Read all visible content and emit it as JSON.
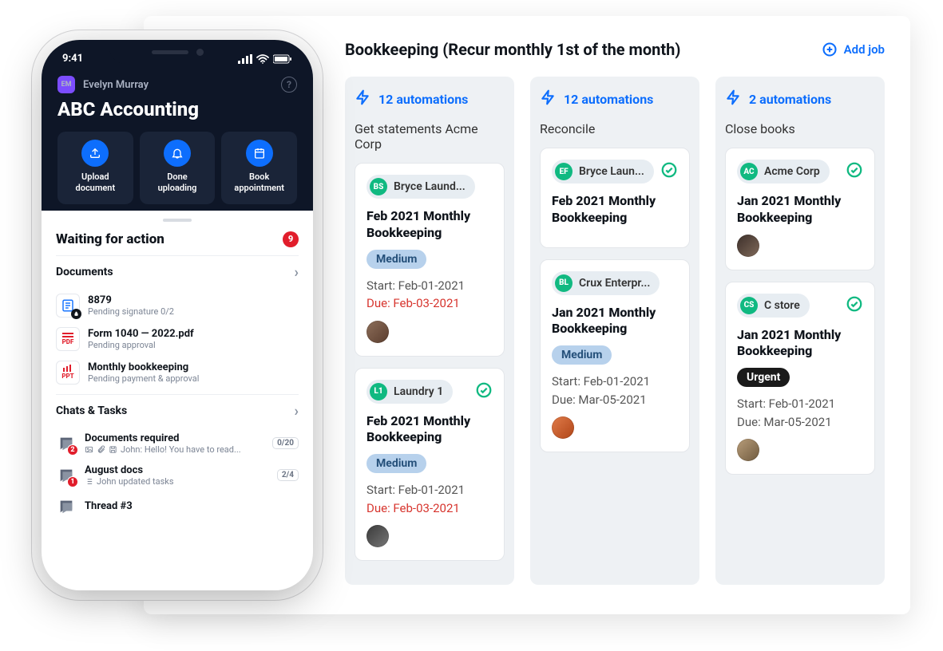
{
  "desk": {
    "title": "Bookkeeping (Recur monthly 1st of the month)",
    "add_label": "Add job",
    "columns": [
      {
        "automations": "12 automations",
        "name": "Get statements Acme Corp",
        "cards": [
          {
            "chip": "BS",
            "chip_color": "#10b981",
            "client": "Bryce Laund...",
            "title": "Feb 2021 Monthly Bookkeeping",
            "badge": "Medium",
            "badge_kind": "medium",
            "start": "Start: Feb-01-2021",
            "due": "Due: Feb-03-2021",
            "due_red": true,
            "avatar": "linear-gradient(135deg,#8d6e5a,#5a3d2e)",
            "check": false
          },
          {
            "chip": "L1",
            "chip_color": "#10b981",
            "client": "Laundry 1",
            "title": "Feb 2021 Monthly Bookkeeping",
            "badge": "Medium",
            "badge_kind": "medium",
            "start": "Start: Feb-01-2021",
            "due": "Due: Feb-03-2021",
            "due_red": true,
            "avatar": "linear-gradient(135deg,#3a3a3a,#777)",
            "check": true
          }
        ]
      },
      {
        "automations": "12 automations",
        "name": "Reconcile",
        "cards": [
          {
            "chip": "EF",
            "chip_color": "#10b981",
            "client": "Bryce Laun...",
            "title": "Feb 2021 Monthly Bookkeeping",
            "badge": "",
            "badge_kind": "",
            "start": "",
            "due": "",
            "due_red": false,
            "avatar": "",
            "check": true
          },
          {
            "chip": "BL",
            "chip_color": "#10b981",
            "client": "Crux Enterpr...",
            "title": "Jan 2021 Monthly Bookkeeping",
            "badge": "Medium",
            "badge_kind": "medium",
            "start": "Start: Feb-01-2021",
            "due": "Due: Mar-05-2021",
            "due_red": false,
            "avatar": "linear-gradient(135deg,#e07b4a,#b04517)",
            "check": false
          }
        ]
      },
      {
        "automations": "2 automations",
        "name": "Close books",
        "cards": [
          {
            "chip": "AC",
            "chip_color": "#10b981",
            "client": "Acme Corp",
            "title": "Jan 2021 Monthly Bookkeeping",
            "badge": "",
            "badge_kind": "",
            "start": "",
            "due": "",
            "due_red": false,
            "avatar": "linear-gradient(135deg,#3c2f2a,#806a5a)",
            "check": true
          },
          {
            "chip": "CS",
            "chip_color": "#10b981",
            "client": "C store",
            "title": "Jan 2021 Monthly Bookkeeping",
            "badge": "Urgent",
            "badge_kind": "urgent",
            "start": "Start: Feb-01-2021",
            "due": "Due: Mar-05-2021",
            "due_red": false,
            "avatar": "linear-gradient(135deg,#b89d7a,#6f5a3e)",
            "check": true
          }
        ]
      }
    ]
  },
  "phone": {
    "time": "9:41",
    "user_initials": "EM",
    "user_name": "Evelyn Murray",
    "org": "ABC Accounting",
    "actions": [
      {
        "icon": "upload",
        "l1": "Upload",
        "l2": "document"
      },
      {
        "icon": "bell",
        "l1": "Done",
        "l2": "uploading"
      },
      {
        "icon": "calendar",
        "l1": "Book",
        "l2": "appointment"
      }
    ],
    "wait_title": "Waiting for action",
    "wait_count": "9",
    "docs_title": "Documents",
    "docs": [
      {
        "icon": "doc-blue",
        "t1": "8879",
        "t2": "Pending signature 0/2",
        "lock": true
      },
      {
        "icon": "pdf",
        "t1": "Form 1040 — 2022.pdf",
        "t2": "Pending approval",
        "lock": false
      },
      {
        "icon": "ppt",
        "t1": "Monthly bookkeeping",
        "t2": "Pending payment & approval",
        "lock": false
      }
    ],
    "chat_title": "Chats & Tasks",
    "chats": [
      {
        "dot": "2",
        "t1": "Documents required",
        "meta": "John: Hello! You have to read...",
        "pill": "0/20",
        "attach": true
      },
      {
        "dot": "1",
        "t1": "August docs",
        "meta": "John updated tasks",
        "pill": "2/4",
        "attach": false
      },
      {
        "dot": "",
        "t1": "Thread #3",
        "meta": "",
        "pill": "",
        "attach": false
      }
    ]
  }
}
